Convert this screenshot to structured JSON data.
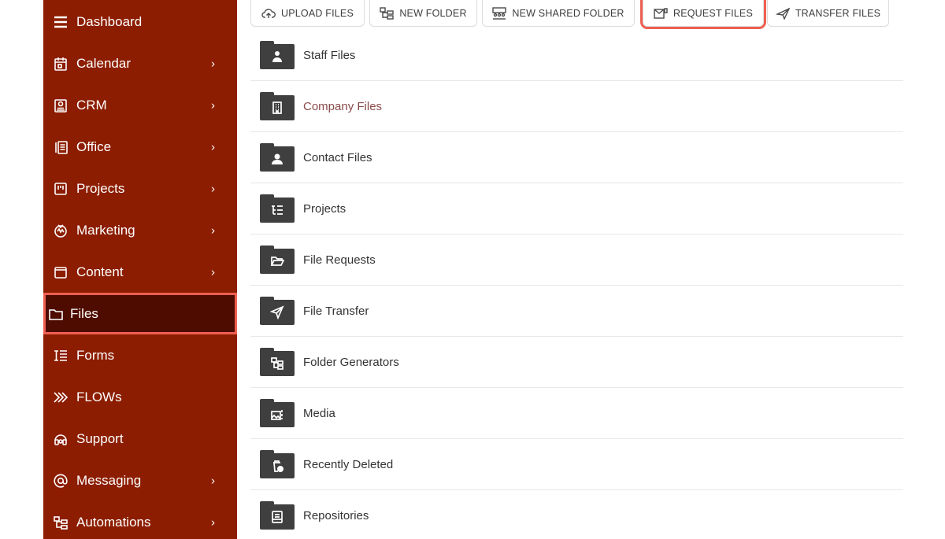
{
  "sidebar": {
    "items": [
      {
        "label": "Dashboard",
        "icon": "menu-icon",
        "chevron": ""
      },
      {
        "label": "Calendar",
        "icon": "calendar-icon",
        "chevron": "›"
      },
      {
        "label": "CRM",
        "icon": "contact-card-icon",
        "chevron": "›"
      },
      {
        "label": "Office",
        "icon": "phone-desk-icon",
        "chevron": "›"
      },
      {
        "label": "Projects",
        "icon": "kanban-icon",
        "chevron": "›"
      },
      {
        "label": "Marketing",
        "icon": "marketing-icon",
        "chevron": "›"
      },
      {
        "label": "Content",
        "icon": "content-window-icon",
        "chevron": "›"
      },
      {
        "label": "Files",
        "icon": "folder-icon",
        "chevron": "",
        "active": true
      },
      {
        "label": "Forms",
        "icon": "form-list-icon",
        "chevron": ""
      },
      {
        "label": "FLOWs",
        "icon": "flow-chevrons-icon",
        "chevron": ""
      },
      {
        "label": "Support",
        "icon": "headset-icon",
        "chevron": ""
      },
      {
        "label": "Messaging",
        "icon": "at-sign-icon",
        "chevron": "›"
      },
      {
        "label": "Automations",
        "icon": "automation-tree-icon",
        "chevron": "›"
      }
    ]
  },
  "toolbar": {
    "upload_label": "UPLOAD FILES",
    "new_folder_label": "NEW FOLDER",
    "new_shared_folder_label": "NEW SHARED FOLDER",
    "request_files_label": "REQUEST FILES",
    "transfer_files_label": "TRANSFER FILES"
  },
  "files": [
    {
      "name": "Staff Files",
      "icon": "staff-icon"
    },
    {
      "name": "Company Files",
      "icon": "building-icon"
    },
    {
      "name": "Contact Files",
      "icon": "person-icon"
    },
    {
      "name": "Projects",
      "icon": "tree-list-icon"
    },
    {
      "name": "File Requests",
      "icon": "open-folder-icon"
    },
    {
      "name": "File Transfer",
      "icon": "paper-plane-icon"
    },
    {
      "name": "Folder Generators",
      "icon": "folder-tree-icon"
    },
    {
      "name": "Media",
      "icon": "media-icon"
    },
    {
      "name": "Recently Deleted",
      "icon": "trash-clock-icon"
    },
    {
      "name": "Repositories",
      "icon": "repository-icon"
    }
  ],
  "colors": {
    "sidebar_bg": "#8c1d00",
    "sidebar_active_bg": "#4e0b00",
    "highlight_outline": "#ee5f4f",
    "folder_icon": "#3f3f3f"
  }
}
